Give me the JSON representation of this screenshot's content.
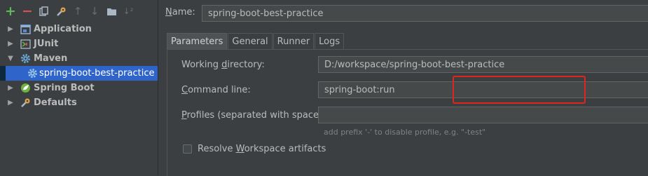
{
  "toolbar": {
    "items": [
      {
        "icon": "plus-icon",
        "glyph": "+"
      },
      {
        "icon": "minus-icon",
        "glyph": "−"
      },
      {
        "icon": "copy-icon",
        "glyph": "⧉"
      },
      {
        "icon": "wrench-icon",
        "glyph": "🔧"
      },
      {
        "icon": "arrow-up-icon",
        "glyph": "↑"
      },
      {
        "icon": "arrow-down-icon",
        "glyph": "↓"
      },
      {
        "icon": "folder-icon",
        "glyph": "▬"
      },
      {
        "icon": "sort-icon",
        "glyph": "↓²"
      }
    ]
  },
  "tree": {
    "application": "Application",
    "junit": "JUnit",
    "maven": "Maven",
    "maven_child": "spring-boot-best-practice",
    "spring_boot": "Spring Boot",
    "defaults": "Defaults"
  },
  "config": {
    "name_label_pre": "",
    "name_label_mnemonic": "N",
    "name_label_post": "ame:",
    "name_value": "spring-boot-best-practice"
  },
  "tabs": [
    "Parameters",
    "General",
    "Runner",
    "Logs"
  ],
  "params": {
    "working_dir_label_pre": "Working ",
    "working_dir_label_mnemonic": "d",
    "working_dir_label_post": "irectory:",
    "working_dir_value": "D:/workspace/spring-boot-best-practice",
    "command_line_label_pre": "",
    "command_line_label_mnemonic": "C",
    "command_line_label_post": "ommand line:",
    "command_line_value": "spring-boot:run",
    "profiles_label_pre": "",
    "profiles_label_mnemonic": "P",
    "profiles_label_post": "rofiles (separated with space):",
    "profiles_value": "",
    "profiles_hint": "add prefix '-' to disable profile, e.g. \"-test\"",
    "resolve_label_pre": "Resolve ",
    "resolve_label_mnemonic": "W",
    "resolve_label_post": "orkspace artifacts"
  },
  "colors": {
    "highlight": "#e0261c",
    "selection": "#2f65ca",
    "background": "#3c3f41"
  }
}
